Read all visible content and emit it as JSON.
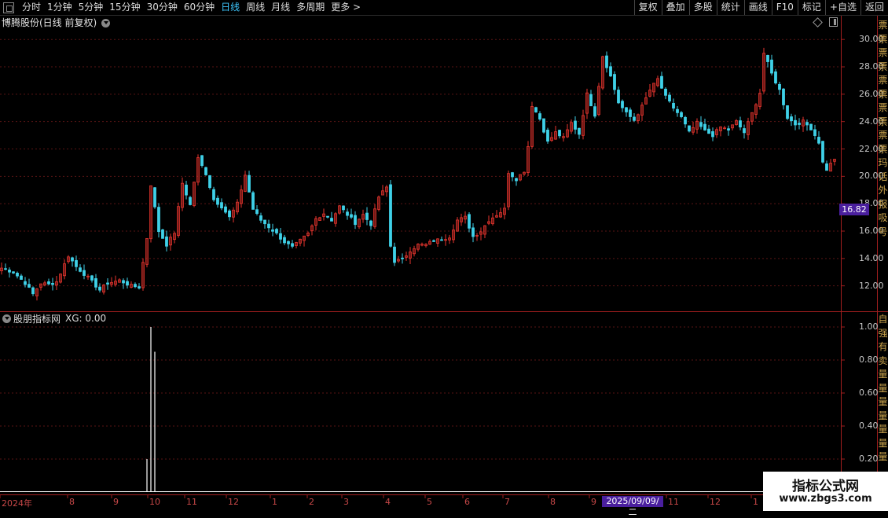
{
  "toolbar": {
    "left": [
      "分时",
      "1分钟",
      "5分钟",
      "15分钟",
      "30分钟",
      "60分钟",
      "日线",
      "周线",
      "月线",
      "多周期",
      "更多 >"
    ],
    "active_index": 6,
    "right": [
      "复权",
      "叠加",
      "多股",
      "统计",
      "画线",
      "F10",
      "标记",
      "+自选",
      "返回"
    ]
  },
  "main_chart": {
    "title": "博腾股份(日线 前复权)",
    "current_price": "16.82",
    "y_ticks": [
      "30.00",
      "28.00",
      "26.00",
      "24.00",
      "22.00",
      "20.00",
      "18.00",
      "16.00",
      "14.00",
      "12.00"
    ],
    "side_text": "票票票票票票票票票票玛话外报吸号"
  },
  "indicator": {
    "name": "股朋指标网",
    "readout": "XG: 0.00",
    "y_ticks": [
      "1.00",
      "0.80",
      "0.60",
      "0.40",
      "0.20"
    ],
    "side_text": "自强有卖量量量量量量量"
  },
  "x_axis": {
    "labels": [
      "2024年",
      "8",
      "9",
      "10",
      "11",
      "12",
      "1",
      "2",
      "3",
      "4",
      "5",
      "6",
      "7",
      "8",
      "9",
      "11",
      "12",
      "1"
    ],
    "cursor_date": "2025/09/09/二"
  },
  "watermark": {
    "name": "指标公式网",
    "url": "www.zbgs3.com"
  },
  "colors": {
    "up": "#e8352e",
    "down": "#3fd1e8",
    "grid": "#5a1414",
    "signal": "#ffffff"
  },
  "chart_data": {
    "type": "candlestick",
    "y_range": [
      10.2,
      30.7
    ],
    "close_keypoints": [
      [
        0,
        13.3
      ],
      [
        3,
        13.0
      ],
      [
        6,
        12.2
      ],
      [
        8,
        11.4
      ],
      [
        10,
        12.2
      ],
      [
        12,
        12.1
      ],
      [
        14,
        12.3
      ],
      [
        17,
        14.2
      ],
      [
        19,
        13.4
      ],
      [
        22,
        12.6
      ],
      [
        25,
        11.7
      ],
      [
        27,
        12.2
      ],
      [
        30,
        12.4
      ],
      [
        33,
        12.0
      ],
      [
        35,
        11.9
      ],
      [
        37,
        15.5
      ],
      [
        38,
        19.4
      ],
      [
        40,
        16.0
      ],
      [
        42,
        15.0
      ],
      [
        44,
        15.9
      ],
      [
        46,
        19.5
      ],
      [
        48,
        17.9
      ],
      [
        50,
        21.3
      ],
      [
        52,
        20.2
      ],
      [
        54,
        18.3
      ],
      [
        56,
        17.8
      ],
      [
        58,
        17.0
      ],
      [
        60,
        18.0
      ],
      [
        62,
        20.1
      ],
      [
        64,
        17.6
      ],
      [
        66,
        16.8
      ],
      [
        68,
        16.3
      ],
      [
        70,
        15.8
      ],
      [
        72,
        15.2
      ],
      [
        74,
        14.8
      ],
      [
        76,
        15.3
      ],
      [
        78,
        15.8
      ],
      [
        80,
        16.9
      ],
      [
        82,
        17.3
      ],
      [
        84,
        16.8
      ],
      [
        86,
        17.8
      ],
      [
        88,
        17.2
      ],
      [
        90,
        16.6
      ],
      [
        92,
        17.2
      ],
      [
        94,
        16.5
      ],
      [
        96,
        18.5
      ],
      [
        98,
        19.2
      ],
      [
        99,
        14.9
      ],
      [
        100,
        13.8
      ],
      [
        102,
        13.9
      ],
      [
        104,
        14.6
      ],
      [
        106,
        15.0
      ],
      [
        108,
        15.0
      ],
      [
        110,
        15.3
      ],
      [
        112,
        15.4
      ],
      [
        114,
        15.6
      ],
      [
        116,
        16.8
      ],
      [
        118,
        17.0
      ],
      [
        120,
        15.6
      ],
      [
        122,
        16.0
      ],
      [
        124,
        16.8
      ],
      [
        126,
        17.2
      ],
      [
        128,
        17.6
      ],
      [
        129,
        20.3
      ],
      [
        131,
        19.8
      ],
      [
        133,
        20.4
      ],
      [
        134,
        22.2
      ],
      [
        135,
        25.2
      ],
      [
        137,
        24.2
      ],
      [
        139,
        22.5
      ],
      [
        141,
        23.2
      ],
      [
        143,
        22.8
      ],
      [
        145,
        23.9
      ],
      [
        147,
        23.1
      ],
      [
        149,
        26.0
      ],
      [
        151,
        24.5
      ],
      [
        153,
        28.8
      ],
      [
        155,
        27.3
      ],
      [
        157,
        25.4
      ],
      [
        159,
        24.6
      ],
      [
        161,
        24.1
      ],
      [
        163,
        25.1
      ],
      [
        165,
        26.3
      ],
      [
        167,
        27.1
      ],
      [
        169,
        25.8
      ],
      [
        171,
        25.0
      ],
      [
        173,
        24.3
      ],
      [
        175,
        23.2
      ],
      [
        177,
        23.9
      ],
      [
        179,
        23.3
      ],
      [
        181,
        23.0
      ],
      [
        183,
        23.6
      ],
      [
        185,
        23.4
      ],
      [
        187,
        24.0
      ],
      [
        189,
        23.2
      ],
      [
        191,
        24.6
      ],
      [
        193,
        26.1
      ],
      [
        194,
        29.0
      ],
      [
        196,
        27.5
      ],
      [
        198,
        26.3
      ],
      [
        200,
        24.3
      ],
      [
        202,
        23.8
      ],
      [
        204,
        24.0
      ],
      [
        206,
        23.5
      ],
      [
        208,
        22.5
      ],
      [
        209,
        21.0
      ],
      [
        210,
        20.5
      ],
      [
        212,
        21.3
      ]
    ],
    "xg_signal_spikes": [
      {
        "bar": 37,
        "value": 0.2
      },
      {
        "bar": 38,
        "value": 1.0
      },
      {
        "bar": 39,
        "value": 0.85
      }
    ]
  }
}
